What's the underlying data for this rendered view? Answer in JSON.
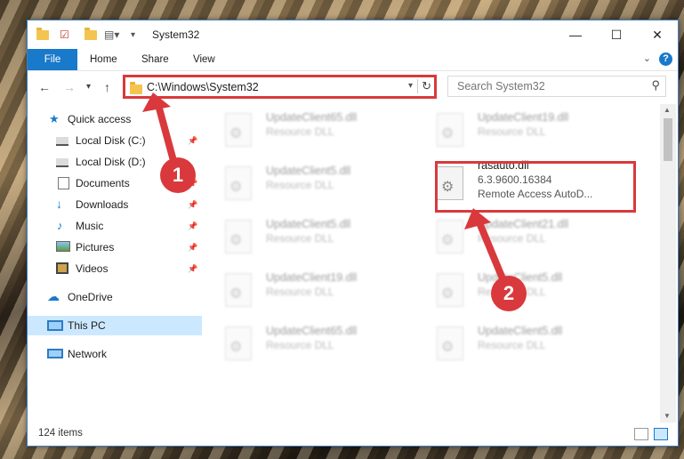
{
  "window": {
    "title": "System32",
    "controls": {
      "minimize": "—",
      "maximize": "☐",
      "close": "✕"
    }
  },
  "ribbon": {
    "tabs": [
      "File",
      "Home",
      "Share",
      "View"
    ],
    "help_label": "?"
  },
  "navigation": {
    "address_path": "C:\\Windows\\System32",
    "search_placeholder": "Search System32"
  },
  "sidebar": {
    "items": [
      {
        "label": "Quick access",
        "icon": "star-icon",
        "pinned": false
      },
      {
        "label": "Local Disk (C:)",
        "icon": "drive-icon",
        "pinned": true
      },
      {
        "label": "Local Disk (D:)",
        "icon": "drive-icon",
        "pinned": true
      },
      {
        "label": "Documents",
        "icon": "documents-icon",
        "pinned": true
      },
      {
        "label": "Downloads",
        "icon": "download-icon",
        "pinned": true
      },
      {
        "label": "Music",
        "icon": "music-icon",
        "pinned": true
      },
      {
        "label": "Pictures",
        "icon": "pictures-icon",
        "pinned": true
      },
      {
        "label": "Videos",
        "icon": "videos-icon",
        "pinned": true
      },
      {
        "label": "OneDrive",
        "icon": "cloud-icon",
        "pinned": false
      },
      {
        "label": "This PC",
        "icon": "computer-icon",
        "pinned": false,
        "selected": true
      },
      {
        "label": "Network",
        "icon": "network-icon",
        "pinned": false
      }
    ]
  },
  "files": [
    {
      "name": "UpdateClient65.dll",
      "sub": "Resource DLL",
      "blurred": true
    },
    {
      "name": "UpdateClient19.dll",
      "sub": "Resource DLL",
      "blurred": true
    },
    {
      "name": "UpdateClient5.dll",
      "sub": "Resource DLL",
      "blurred": true
    },
    {
      "name": "rasauto.dll",
      "version": "6.3.9600.16384",
      "sub": "Remote Access AutoD...",
      "blurred": false
    },
    {
      "name": "UpdateClient5.dll",
      "sub": "Resource DLL",
      "blurred": true
    },
    {
      "name": "UpdateClient21.dll",
      "sub": "Resource DLL",
      "blurred": true
    },
    {
      "name": "UpdateClient19.dll",
      "sub": "Resource DLL",
      "blurred": true
    },
    {
      "name": "UpdateClient5.dll",
      "sub": "Resource DLL",
      "blurred": true
    },
    {
      "name": "UpdateClient65.dll",
      "sub": "Resource DLL",
      "blurred": true
    },
    {
      "name": "UpdateClient5.dll",
      "sub": "Resource DLL",
      "blurred": true
    }
  ],
  "status": {
    "item_count": "124 items"
  },
  "annotations": {
    "step1": "1",
    "step2": "2"
  },
  "colors": {
    "accent": "#1979ca",
    "highlight": "#d9393c",
    "selected_bg": "#cce8ff"
  }
}
